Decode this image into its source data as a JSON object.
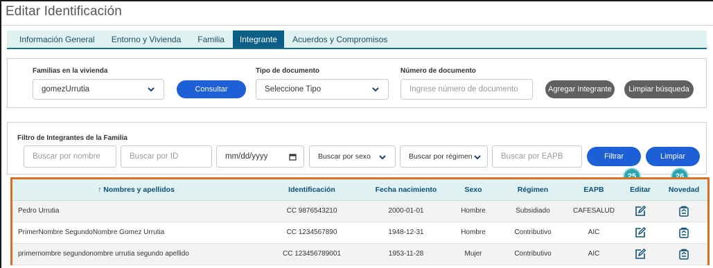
{
  "window": {
    "title": "Editar Identificación"
  },
  "tabs": [
    {
      "label": "Información General",
      "active": false
    },
    {
      "label": "Entorno y Vivienda",
      "active": false
    },
    {
      "label": "Familia",
      "active": false
    },
    {
      "label": "Integrante",
      "active": true
    },
    {
      "label": "Acuerdos y Compromisos",
      "active": false
    }
  ],
  "search": {
    "familias_label": "Familias en la vivienda",
    "familias_value": "gomezUrrutia",
    "consultar_label": "Consultar",
    "tipo_doc_label": "Tipo de documento",
    "tipo_doc_value": "Seleccione Tipo",
    "num_doc_label": "Número de documento",
    "num_doc_placeholder": "Ingrese número de documento",
    "agregar_label": "Agregar Integrante",
    "limpiar_busqueda_label": "Limpiar búsqueda"
  },
  "filter": {
    "title": "Filtro de Integrantes de la Familia",
    "nombre_placeholder": "Buscar por nombre",
    "id_placeholder": "Buscar por ID",
    "date_placeholder": "mm/dd/yyyy",
    "sexo_value": "Buscar por sexo",
    "regimen_value": "Buscar por régimen",
    "eapb_placeholder": "Buscar por EAPB",
    "filtrar_label": "Filtrar",
    "limpiar_label": "Limpiar"
  },
  "table": {
    "headers": {
      "nombres": "↑ Nombres y apellidos",
      "identificacion": "Identificación",
      "fecha": "Fecha nacimiento",
      "sexo": "Sexo",
      "regimen": "Régimen",
      "eapb": "EAPB",
      "editar": "Editar",
      "novedad": "Novedad"
    },
    "rows": [
      {
        "nombre": "Pedro Urrutia",
        "id": "CC 9876543210",
        "fecha": "2000-01-01",
        "sexo": "Hombre",
        "regimen": "Subsidiado",
        "eapb": "CAFESALUD"
      },
      {
        "nombre": "PrimerNombre SegundoNombre Gomez Urrutia",
        "id": "CC 1234567890",
        "fecha": "1948-12-31",
        "sexo": "Hombre",
        "regimen": "Contributivo",
        "eapb": "AIC"
      },
      {
        "nombre": "primernombre segundonombre urrutia segundo apellido",
        "id": "CC 123456789001",
        "fecha": "1953-11-28",
        "sexo": "Mujer",
        "regimen": "Contributivo",
        "eapb": "AIC"
      }
    ]
  },
  "badges": {
    "editar": "25",
    "novedad": "26"
  },
  "icons": {
    "edit": "edit-icon",
    "novedad": "clipboard-icon",
    "dropdown": "chevron-down-icon",
    "calendar": "calendar-icon"
  },
  "colors": {
    "accent": "#1c5fd6",
    "header_bg": "#dff1f1",
    "active_tab": "#0b5e86",
    "highlight": "#d96e22",
    "badge": "#2aa6b2"
  }
}
